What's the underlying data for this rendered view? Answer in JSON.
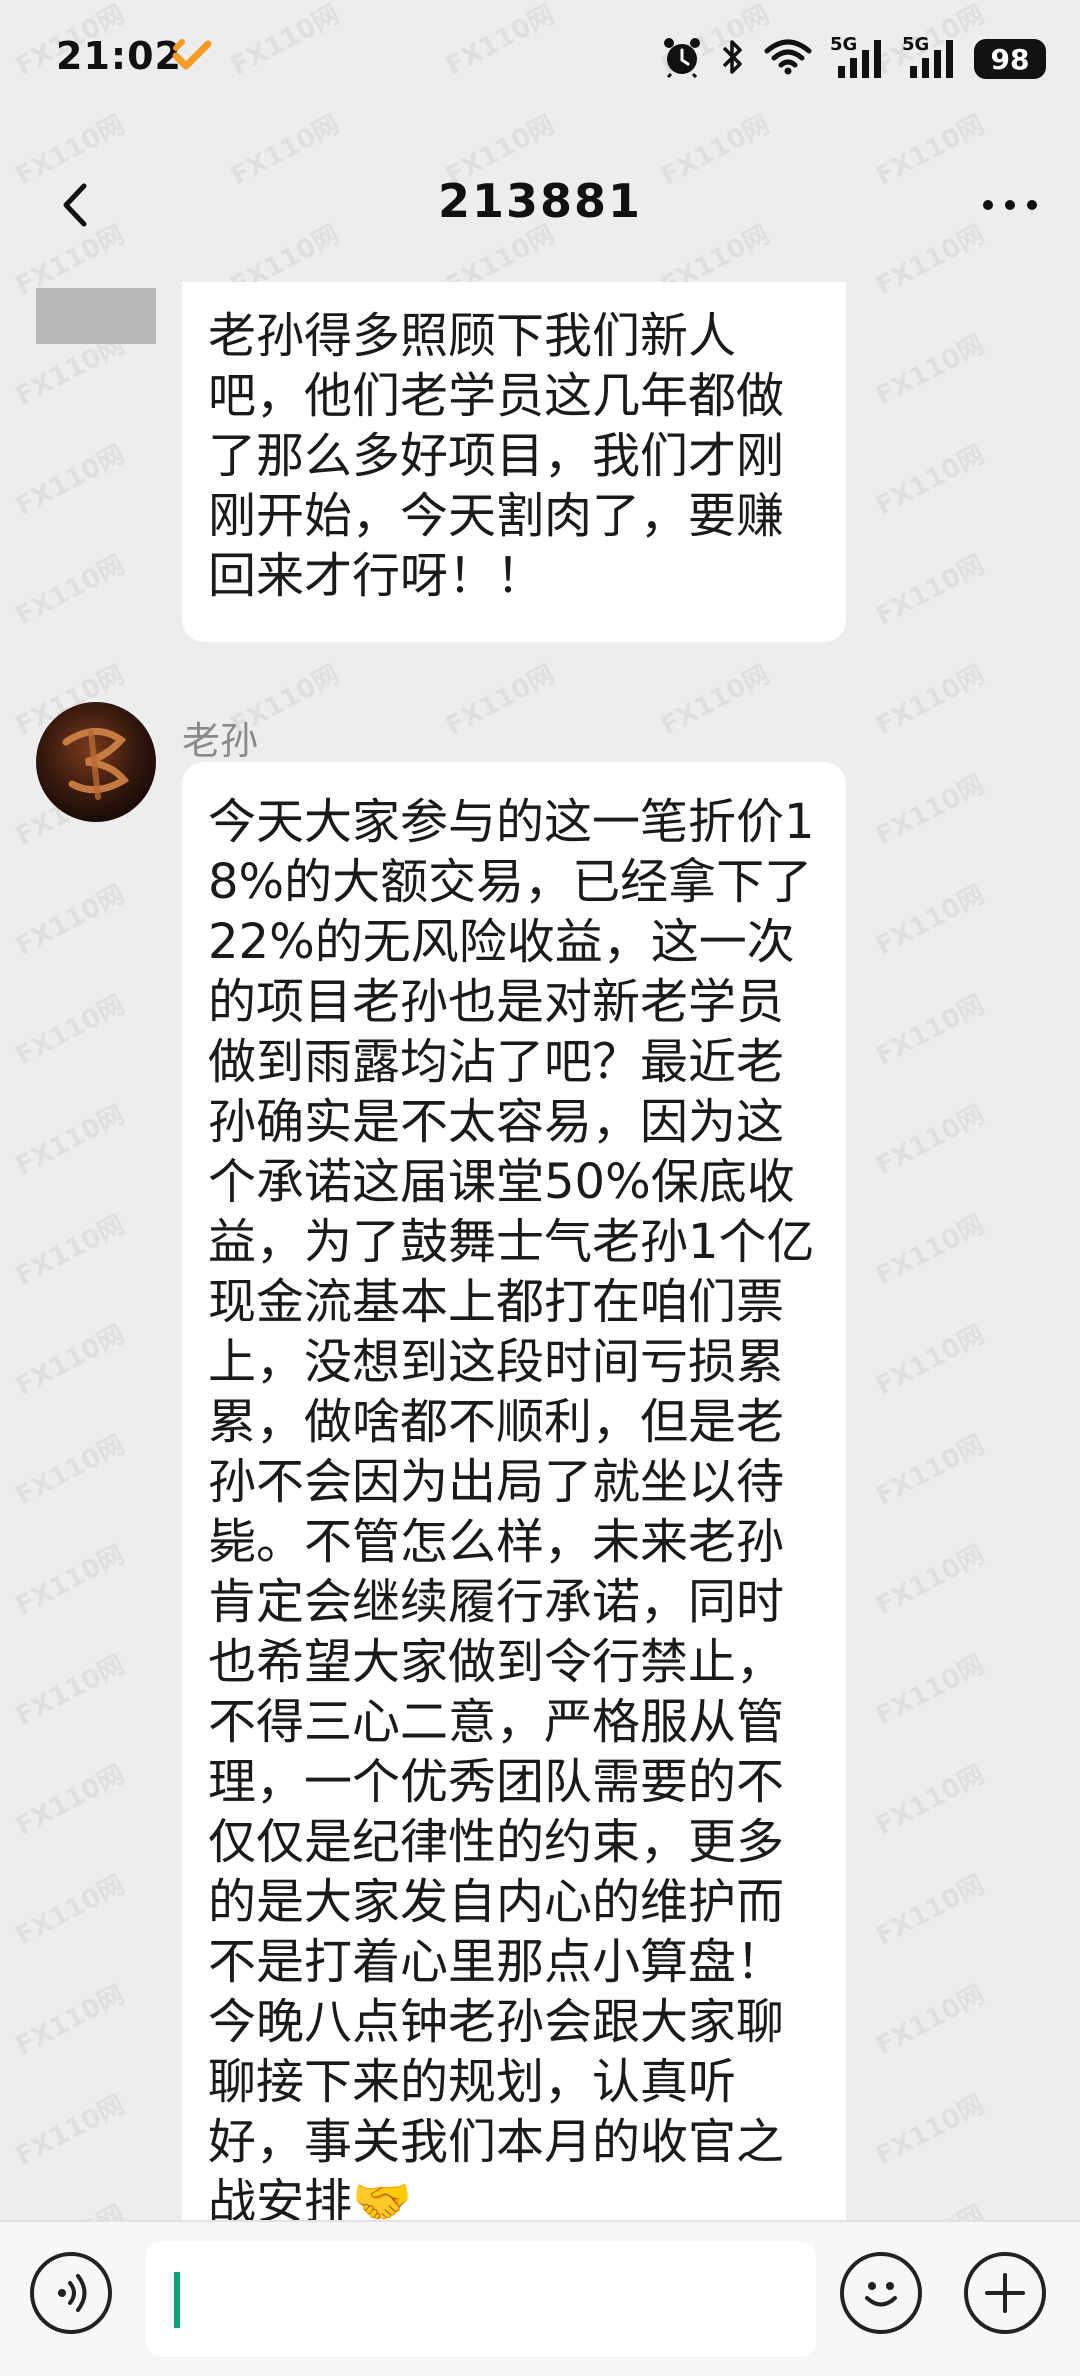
{
  "status_bar": {
    "time": "21:02",
    "battery": "98",
    "icons": [
      "alarm-icon",
      "bluetooth-icon",
      "wifi-icon",
      "signal-5g-icon",
      "signal-5g-icon"
    ],
    "signal_labels": [
      "5G",
      "5G"
    ]
  },
  "header": {
    "title": "213881"
  },
  "messages": [
    {
      "text": "老孙得多照顾下我们新人吧，他们老学员这几年都做了那么多好项目，我们才刚刚开始，今天割肉了，要赚回来才行呀！！"
    },
    {
      "sender": "老孙",
      "text": "今天大家参与的这一笔折价18%的大额交易，已经拿下了22%的无风险收益，这一次的项目老孙也是对新老学员做到雨露均沾了吧？最近老孙确实是不太容易，因为这个承诺这届课堂50%保底收益，为了鼓舞士气老孙1个亿现金流基本上都打在咱们票上，没想到这段时间亏损累累，做啥都不顺利，但是老孙不会因为出局了就坐以待毙。不管怎么样，未来老孙肯定会继续履行承诺，同时也希望大家做到令行禁止，不得三心二意，严格服从管理，一个优秀团队需要的不仅仅是纪律性的约束，更多的是大家发自内心的维护而不是打着心里那点小算盘！今晚八点钟老孙会跟大家聊聊接下来的规划，认真听好，事关我们本月的收官之战安排🤝"
    }
  ],
  "watermark": "FX110网",
  "colors": {
    "background": "#ededed",
    "bubble": "#ffffff",
    "caret": "#07a17a"
  }
}
